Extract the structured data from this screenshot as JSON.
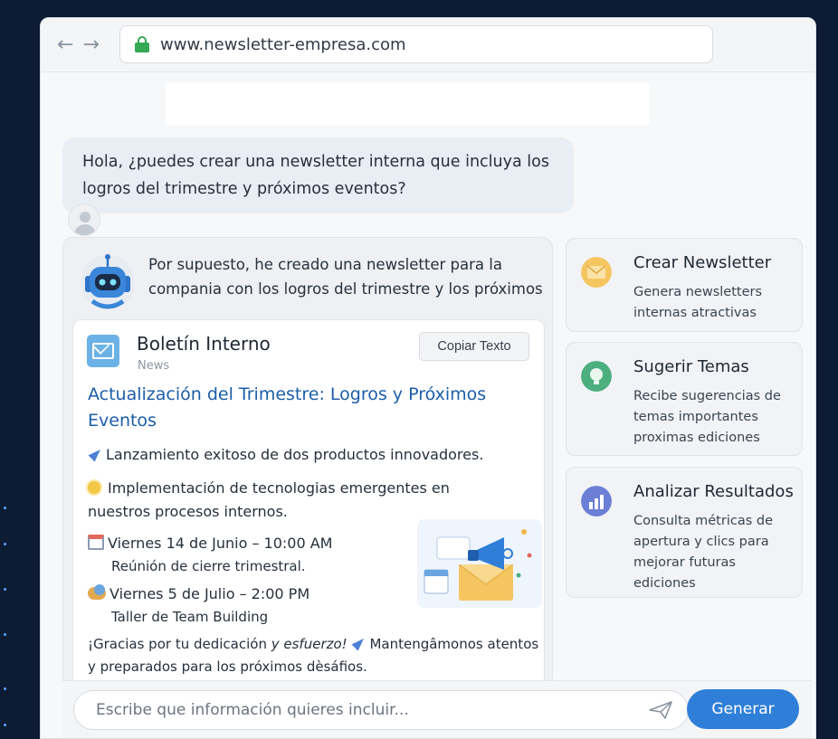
{
  "browser": {
    "url": "www.newsletter-empresa.com"
  },
  "chat": {
    "user_message": "Hola, ¿puedes crear una newsletter interna que incluya los logros del trimestre y próximos eventos?",
    "assistant_intro": "Por supuesto, he creado una newsletter para la compania con los logros del trimestre y los próximos"
  },
  "newsletter": {
    "title": "Boletín Interno",
    "subtitle": "News",
    "copy_label": "Copiar Texto",
    "headline": "Actualización del Trimestre: Logros y Próximos Eventos",
    "achievement_1": "Lanzamiento exitoso de dos productos innovadores.",
    "achievement_2": "Implementación de tecnologias emergentes en nuestros procesos internos.",
    "event_1_date": "Viernes 14 de Junio – 10:00 AM",
    "event_1_desc": "Reúnión de cierre trimestral.",
    "event_2_date": "Viernes 5 de Julio – 2:00 PM",
    "event_2_desc": "Taller de Team Building",
    "closing_a": "¡Gracias por tu dedicación",
    "closing_b": "y esfuerzo!",
    "closing_c": "Mantengâmonos",
    "closing_d": "atentos y preparados para los próximos dèsáfios."
  },
  "features": [
    {
      "title": "Crear Newsletter",
      "desc": "Genera newsletters internas atractivas",
      "icon": "envelope-icon",
      "color": "#f2b54a"
    },
    {
      "title": "Sugerir Temas",
      "desc": "Recibe sugerencias de temas importantes proximas ediciones",
      "icon": "lightbulb-icon",
      "color": "#4caf7d"
    },
    {
      "title": "Analizar Resultados",
      "desc": "Consulta métricas de apertura y clics para mejorar futuras ediciones",
      "icon": "bar-chart-icon",
      "color": "#6b7fd6"
    }
  ],
  "composer": {
    "placeholder": "Escribe que información quieres incluir...",
    "generate_label": "Generar"
  }
}
